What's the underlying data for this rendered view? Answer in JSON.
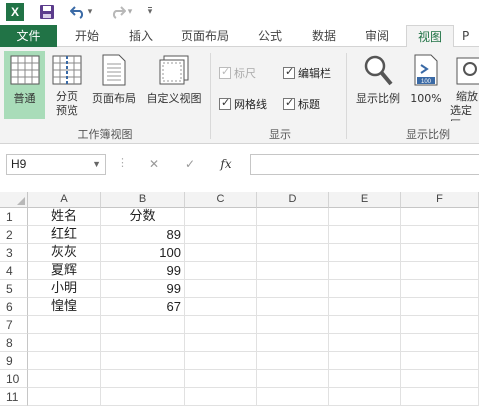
{
  "quick_access": {
    "logo": "X",
    "undo_caret": "▾",
    "redo_caret": "▾",
    "more": "▾"
  },
  "tabs": [
    "文件",
    "开始",
    "插入",
    "页面布局",
    "公式",
    "数据",
    "审阅",
    "视图",
    "P"
  ],
  "active_tab": "视图",
  "ribbon": {
    "workbook_views": {
      "label": "工作簿视图",
      "buttons": [
        {
          "icon": "normal-view-icon",
          "label": "普通",
          "active": true
        },
        {
          "icon": "page-break-preview-icon",
          "label_line1": "分页",
          "label_line2": "预览"
        },
        {
          "icon": "page-layout-icon",
          "label": "页面布局"
        },
        {
          "icon": "custom-views-icon",
          "label": "自定义视图"
        }
      ]
    },
    "show": {
      "label": "显示",
      "checks": [
        {
          "label": "标尺",
          "checked": true,
          "disabled": true
        },
        {
          "label": "编辑栏",
          "checked": true
        },
        {
          "label": "网格线",
          "checked": true
        },
        {
          "label": "标题",
          "checked": true
        }
      ]
    },
    "zoom": {
      "label": "显示比例",
      "buttons": [
        {
          "icon": "zoom-magnifier-icon",
          "label": "显示比例"
        },
        {
          "icon": "zoom-100-icon",
          "label": "100%",
          "icon_text": "100"
        },
        {
          "icon": "zoom-to-selection-icon",
          "label_line1": "缩放",
          "label_line2": "选定区"
        }
      ]
    }
  },
  "formula_bar": {
    "name_box": "H9",
    "cancel": "✕",
    "enter": "✓",
    "fx": "fx",
    "dots": "⋮",
    "value": ""
  },
  "sheet": {
    "columns": [
      "A",
      "B",
      "C",
      "D",
      "E",
      "F"
    ],
    "rows": [
      "1",
      "2",
      "3",
      "4",
      "5",
      "6",
      "7",
      "8",
      "9",
      "10",
      "11"
    ],
    "data": [
      [
        "姓名",
        "分数"
      ],
      [
        "红红",
        "89"
      ],
      [
        "灰灰",
        "100"
      ],
      [
        "夏辉",
        "99"
      ],
      [
        "小明",
        "99"
      ],
      [
        "惶惶",
        "67"
      ]
    ]
  },
  "colors": {
    "brand": "#217346",
    "active_view": "#a9dcb9"
  }
}
